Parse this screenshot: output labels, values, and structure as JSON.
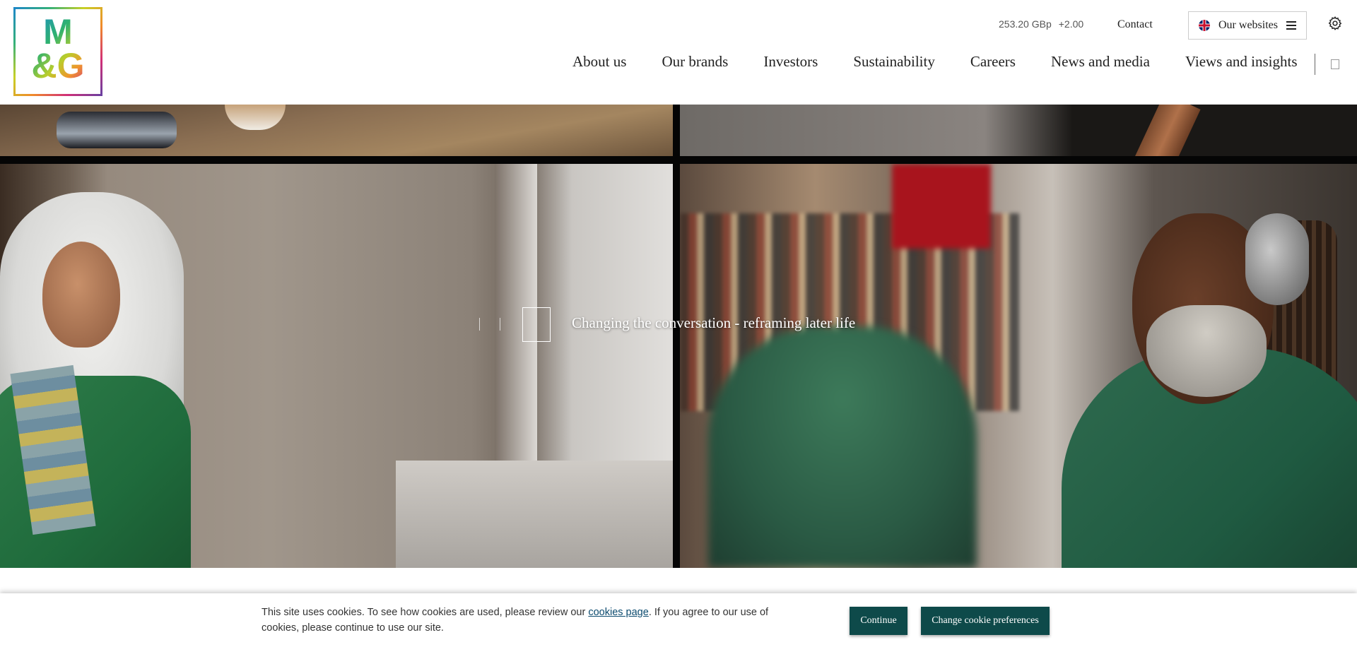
{
  "brand": {
    "logo_text_line1": "M",
    "logo_text_line2": "&G"
  },
  "share_price": {
    "value": "253.20 GBp",
    "change": "+2.00"
  },
  "utility": {
    "contact_label": "Contact",
    "websites_label": "Our websites"
  },
  "nav": {
    "items": [
      {
        "label": "About us"
      },
      {
        "label": "Our brands"
      },
      {
        "label": "Investors"
      },
      {
        "label": "Sustainability"
      },
      {
        "label": "Careers"
      },
      {
        "label": "News and media"
      },
      {
        "label": "Views and insights"
      }
    ]
  },
  "hero": {
    "caption": "Changing the conversation - reframing later life"
  },
  "cookie": {
    "text_before": "This site uses cookies. To see how cookies are used, please review our ",
    "link_label": "cookies page",
    "text_after": ". If you agree to our use of cookies, please continue to use our site.",
    "continue_label": "Continue",
    "preferences_label": "Change cookie preferences"
  },
  "colors": {
    "button_bg": "#0e4a4a",
    "link": "#0b4a6e"
  },
  "icons": [
    "uk-flag-icon",
    "hamburger-menu-icon",
    "gear-icon",
    "search-icon",
    "play-icon"
  ]
}
